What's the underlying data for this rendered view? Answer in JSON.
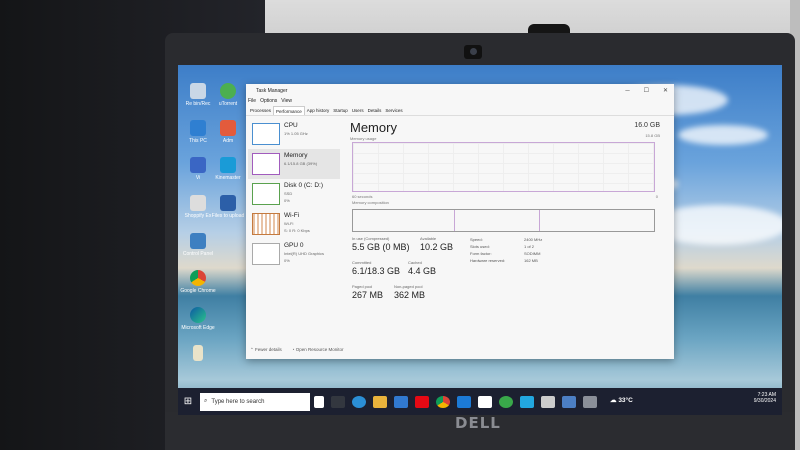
{
  "desktop_icons": [
    {
      "label": "Re bin/Rec"
    },
    {
      "label": "uTorrent"
    },
    {
      "label": "This PC"
    },
    {
      "label": "Adm"
    },
    {
      "label": "Vi"
    },
    {
      "label": "Kinemaster"
    },
    {
      "label": "Shoppify Ex"
    },
    {
      "label": "Files to upload"
    },
    {
      "label": "Control Panel"
    },
    {
      "label": "Google Chrome"
    },
    {
      "label": "Microsoft Edge"
    }
  ],
  "task_manager": {
    "title": "Task Manager",
    "menu": [
      "File",
      "Options",
      "View"
    ],
    "tabs": [
      "Processes",
      "Performance",
      "App history",
      "Startup",
      "Users",
      "Details",
      "Services"
    ],
    "resources": [
      {
        "name": "CPU",
        "sub": "1% 1.05 GHz"
      },
      {
        "name": "Memory",
        "sub": "6.1/15.8 GB (39%)"
      },
      {
        "name": "Disk 0 (C: D:)",
        "sub": "SSD",
        "sub2": "0%"
      },
      {
        "name": "Wi-Fi",
        "sub": "Wi-Fi",
        "sub2": "S: 0 R: 0 Kbps"
      },
      {
        "name": "GPU 0",
        "sub": "Intel(R) UHD Graphics",
        "sub2": "0%"
      }
    ],
    "main": {
      "title": "Memory",
      "total": "16.0 GB",
      "usage_label": "Memory usage",
      "max": "15.8 GB",
      "time_label": "60 seconds",
      "zero": "0",
      "composition_label": "Memory composition",
      "stats": [
        {
          "label": "In use (Compressed)",
          "value": "5.5 GB (0 MB)"
        },
        {
          "label": "Available",
          "value": "10.2 GB"
        },
        {
          "label": "Committed",
          "value": "6.1/18.3 GB"
        },
        {
          "label": "Cached",
          "value": "4.4 GB"
        },
        {
          "label": "Paged pool",
          "value": "267 MB"
        },
        {
          "label": "Non-paged pool",
          "value": "362 MB"
        }
      ],
      "spec": [
        {
          "k": "Speed:",
          "v": "2400 MHz"
        },
        {
          "k": "Slots used:",
          "v": "1 of 2"
        },
        {
          "k": "Form factor:",
          "v": "SODIMM"
        },
        {
          "k": "Hardware reserved:",
          "v": "162 MB"
        }
      ]
    },
    "footer": {
      "fewer": "Fewer details",
      "monitor": "Open Resource Monitor"
    }
  },
  "taskbar": {
    "search_placeholder": "Type here to search",
    "weather": "33°C",
    "time": "7:23 AM",
    "date": "9/30/2024"
  },
  "brand": "DELL"
}
